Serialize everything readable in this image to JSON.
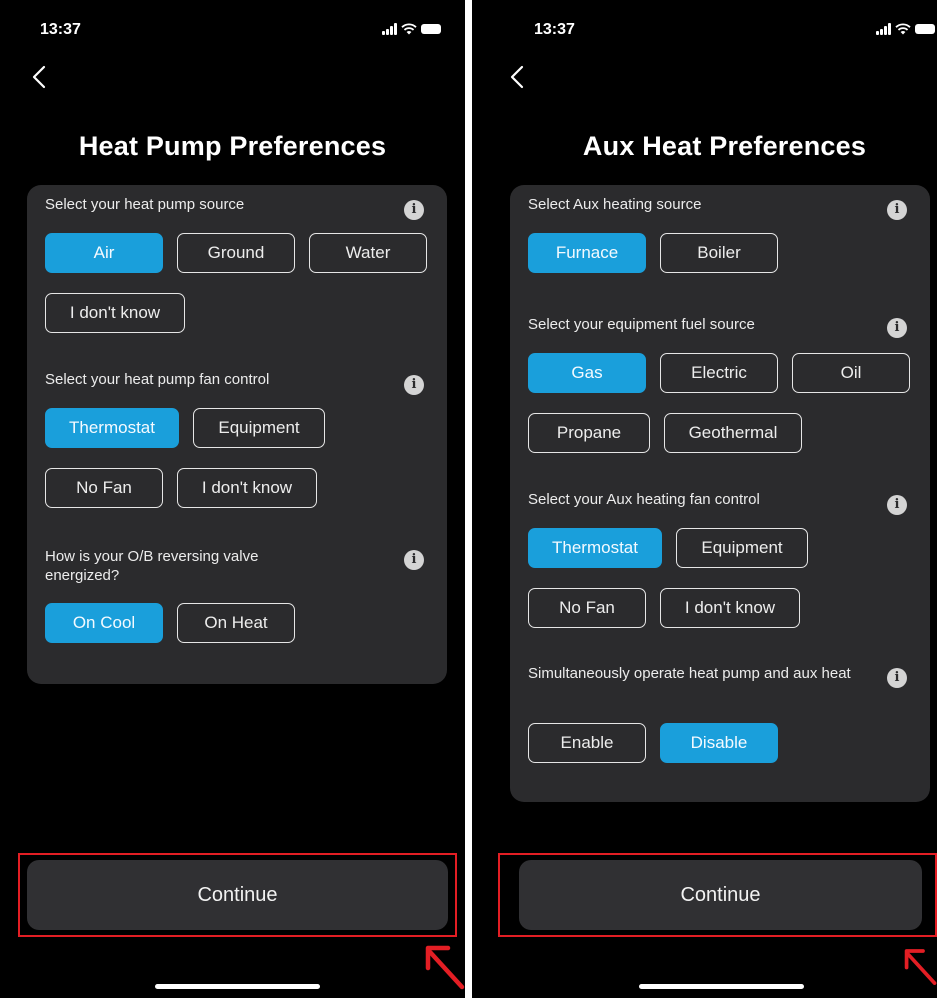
{
  "status_bar": {
    "time": "13:37"
  },
  "left_screen": {
    "title": "Heat Pump Preferences",
    "sections": [
      {
        "question": "Select your heat pump source",
        "options": [
          "Air",
          "Ground",
          "Water",
          "I don't know"
        ],
        "selected": "Air"
      },
      {
        "question": "Select your heat pump fan control",
        "options": [
          "Thermostat",
          "Equipment",
          "No Fan",
          "I don't know"
        ],
        "selected": "Thermostat"
      },
      {
        "question": "How is your O/B reversing valve energized?",
        "options": [
          "On Cool",
          "On Heat"
        ],
        "selected": "On Cool"
      }
    ],
    "continue_label": "Continue"
  },
  "right_screen": {
    "title": "Aux Heat Preferences",
    "sections": [
      {
        "question": "Select Aux heating source",
        "options": [
          "Furnace",
          "Boiler"
        ],
        "selected": "Furnace"
      },
      {
        "question": "Select your equipment fuel source",
        "options": [
          "Gas",
          "Electric",
          "Oil",
          "Propane",
          "Geothermal"
        ],
        "selected": "Gas"
      },
      {
        "question": "Select your Aux heating fan control",
        "options": [
          "Thermostat",
          "Equipment",
          "No Fan",
          "I don't know"
        ],
        "selected": "Thermostat"
      },
      {
        "question": "Simultaneously operate heat pump and aux heat",
        "options": [
          "Enable",
          "Disable"
        ],
        "selected": "Disable"
      }
    ],
    "continue_label": "Continue"
  },
  "info_glyph": "i",
  "colors": {
    "accent": "#1a9fdb",
    "card": "#2b2b2d",
    "background": "#000000",
    "highlight": "#e31e24"
  },
  "icons": {
    "back": "chevron-left-icon",
    "info": "info-icon",
    "annotation": "red-arrow-icon"
  }
}
